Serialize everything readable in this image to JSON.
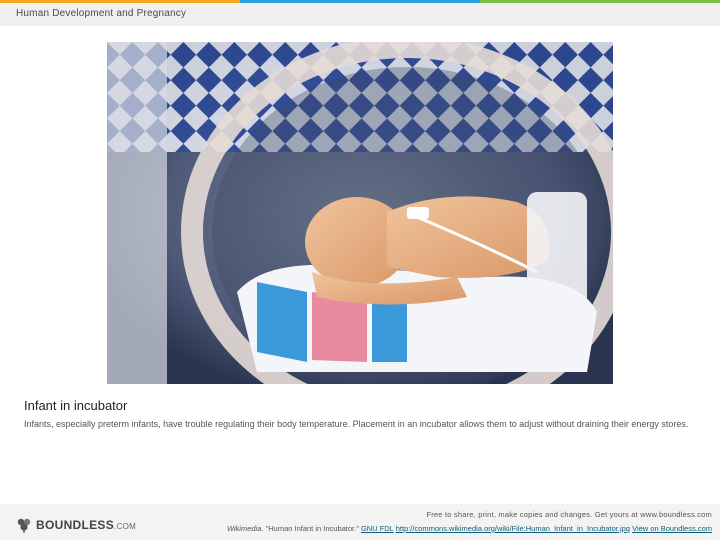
{
  "header": {
    "title": "Human Development and Pregnancy"
  },
  "accent_colors": [
    "#f5a623",
    "#2a9fd6",
    "#7cc142"
  ],
  "image": {
    "subject": "infant-in-incubator-photo"
  },
  "caption": {
    "title": "Infant in incubator",
    "text": "Infants, especially preterm infants, have trouble regulating their body temperature. Placement in an incubator allows them to adjust without draining their energy stores."
  },
  "footer": {
    "logo_text": "BOUNDLESS",
    "logo_suffix": ".COM",
    "line1": "Free to share, print, make copies and changes. Get yours at www.boundless.com",
    "source": "Wikimedia",
    "source_title": ". \"Human Infant in Incubator.\" ",
    "license": "GNU FDL",
    "url": "http://commons.wikimedia.org/wiki/File:Human_Infant_in_Incubator.jpg",
    "view_link": "View on Boundless.com"
  }
}
